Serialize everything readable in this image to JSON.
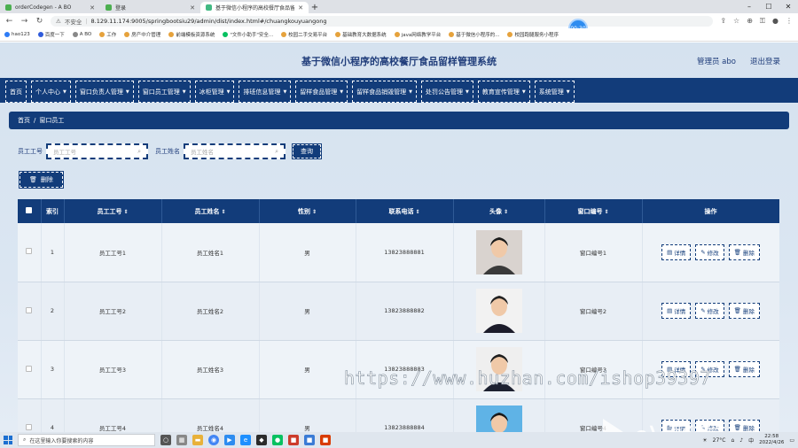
{
  "browser": {
    "tabs": [
      {
        "label": "orderCodegen - A BO",
        "fav_color": "#4caf50"
      },
      {
        "label": "登录",
        "fav_color": "#4caf50"
      },
      {
        "label": "基于微信小程序的高校餐厅食品留...",
        "fav_color": "#42b983"
      }
    ],
    "address": {
      "security": "不安全",
      "url": "8.129.11.174:9005/springbootsiu29/admin/dist/index.html#/chuangkouyuangong"
    },
    "timer": "00:30",
    "bookmarks": [
      {
        "label": "hao123",
        "color": "#2d7cf6"
      },
      {
        "label": "百度一下",
        "color": "#2f5bdb"
      },
      {
        "label": "A BO",
        "color": "#888"
      },
      {
        "label": "工作",
        "color": "#e6a23c"
      },
      {
        "label": "房产中介管理",
        "color": "#e6a23c"
      },
      {
        "label": "前端模板资源系统",
        "color": "#e6a23c"
      },
      {
        "label": "\"文件小助手\"安全...",
        "color": "#07c160"
      },
      {
        "label": "校园二手交易平台",
        "color": "#e6a23c"
      },
      {
        "label": "基础教育大数据系统",
        "color": "#e6a23c"
      },
      {
        "label": "java网络教学平台",
        "color": "#e6a23c"
      },
      {
        "label": "基于微信小程序的...",
        "color": "#e6a23c"
      },
      {
        "label": "校园跑腿服务小程序",
        "color": "#e6a23c"
      }
    ]
  },
  "header": {
    "title": "基于微信小程序的高校餐厅食品留样管理系统",
    "user": "管理员 abo",
    "logout": "退出登录"
  },
  "nav": [
    {
      "label": "首页",
      "chev": false
    },
    {
      "label": "个人中心",
      "chev": true
    },
    {
      "label": "窗口负责人管理",
      "chev": true
    },
    {
      "label": "窗口员工管理",
      "chev": true
    },
    {
      "label": "冰柜管理",
      "chev": true
    },
    {
      "label": "排班信息管理",
      "chev": true
    },
    {
      "label": "留样食品管理",
      "chev": true
    },
    {
      "label": "留样食品销毁管理",
      "chev": true
    },
    {
      "label": "处罚公告管理",
      "chev": true
    },
    {
      "label": "教育宣传管理",
      "chev": true
    },
    {
      "label": "系统管理",
      "chev": true
    }
  ],
  "breadcrumb": {
    "home": "首页",
    "sep": "/",
    "current": "窗口员工"
  },
  "search": {
    "emp_no_label": "员工工号",
    "emp_no_placeholder": "员工工号",
    "emp_name_label": "员工姓名",
    "emp_name_placeholder": "员工姓名",
    "query": "查询"
  },
  "delete_button": "删除",
  "table": {
    "headers": {
      "index": "索引",
      "emp_no": "员工工号",
      "emp_name": "员工姓名",
      "gender": "性别",
      "phone": "联系电话",
      "avatar": "头像",
      "window_no": "窗口编号",
      "ops": "操作"
    },
    "ops": {
      "detail": "详情",
      "edit": "修改",
      "delete": "删除"
    },
    "rows": [
      {
        "index": "1",
        "emp_no": "员工工号1",
        "emp_name": "员工姓名1",
        "gender": "男",
        "phone": "13823888881",
        "window_no": "窗口编号1"
      },
      {
        "index": "2",
        "emp_no": "员工工号2",
        "emp_name": "员工姓名2",
        "gender": "男",
        "phone": "13823888882",
        "window_no": "窗口编号2"
      },
      {
        "index": "3",
        "emp_no": "员工工号3",
        "emp_name": "员工姓名3",
        "gender": "男",
        "phone": "13823888883",
        "window_no": "窗口编号3"
      },
      {
        "index": "4",
        "emp_no": "员工工号4",
        "emp_name": "员工姓名4",
        "gender": "男",
        "phone": "13823888884",
        "window_no": "窗口编号4"
      }
    ]
  },
  "watermark": {
    "url": "https://www.huzhan.com/ishop39397",
    "ev": "eV剪辑"
  },
  "taskbar": {
    "search_placeholder": "在这里输入你要搜索的内容",
    "weather": "27°C",
    "time": "22:58",
    "date": "2022/4/26"
  },
  "colors": {
    "primary": "#123c7a",
    "bg": "#d8e4f0"
  }
}
